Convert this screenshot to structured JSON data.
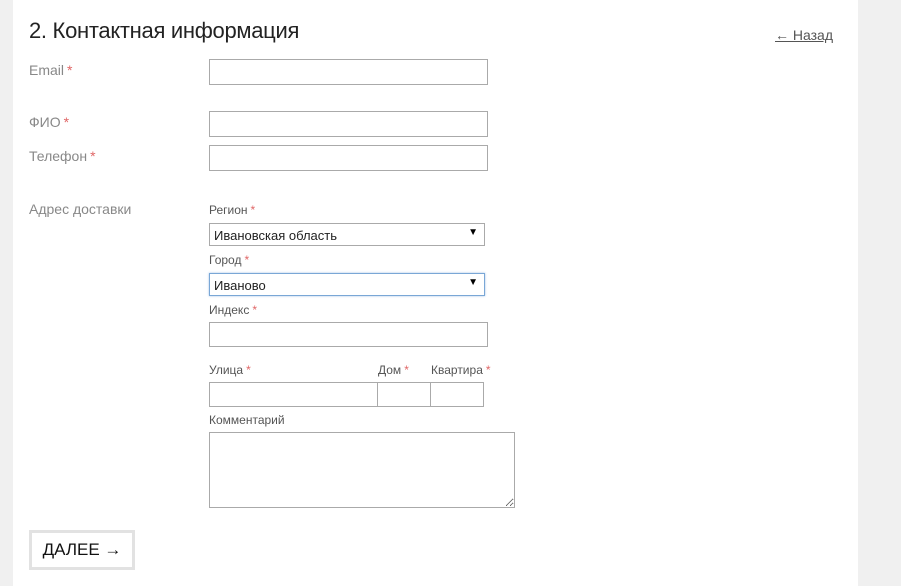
{
  "section": {
    "title": "2. Контактная информация",
    "back_label": "← Назад"
  },
  "required_mark": "*",
  "fields": {
    "email": {
      "label": "Email",
      "value": ""
    },
    "fio": {
      "label": "ФИО",
      "value": ""
    },
    "phone": {
      "label": "Телефон",
      "value": ""
    }
  },
  "address": {
    "label": "Адрес доставки",
    "region": {
      "label": "Регион",
      "value": "Ивановская область"
    },
    "city": {
      "label": "Город",
      "value": "Иваново"
    },
    "index": {
      "label": "Индекс",
      "value": ""
    },
    "street": {
      "label": "Улица",
      "value": ""
    },
    "house": {
      "label": "Дом",
      "value": ""
    },
    "apartment": {
      "label": "Квартира",
      "value": ""
    },
    "comment": {
      "label": "Комментарий",
      "value": ""
    }
  },
  "next_button": {
    "label": "ДАЛЕЕ →"
  },
  "icons": {
    "dropdown_arrow": "▼"
  }
}
